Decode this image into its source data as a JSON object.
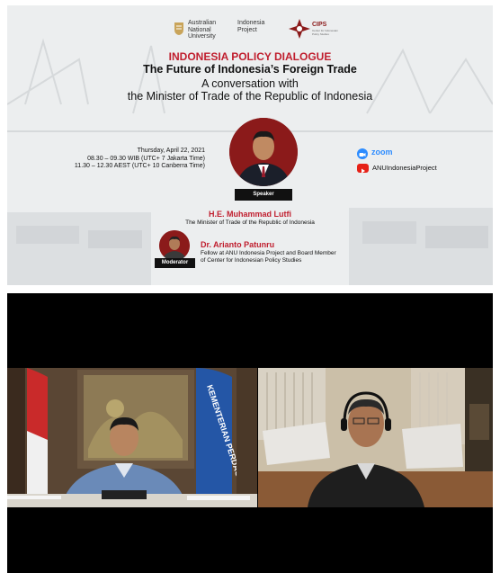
{
  "logos": {
    "anu": "Australian\nNational\nUniversity",
    "indonesia_project": "Indonesia\nProject",
    "cips": "CIPS",
    "cips_tagline": "Center for Indonesian Policy Studies"
  },
  "event": {
    "title": "INDONESIA POLICY DIALOGUE",
    "subtitle": "The Future of Indonesia’s Foreign Trade",
    "line3": "A conversation with",
    "line4": "the Minister of Trade of the Republic of Indonesia"
  },
  "schedule": {
    "date": "Thursday, April 22, 2021",
    "wib": "08.30 – 09.30 WIB (UTC+ 7 Jakarta Time)",
    "aest": "11.30 – 12.30 AEST (UTC+ 10 Canberra Time)"
  },
  "speaker": {
    "badge": "Speaker",
    "name": "H.E. Muhammad Lutfi",
    "role": "The Minister of Trade of the Republic of Indonesia"
  },
  "platforms": {
    "zoom": "zoom",
    "youtube": "ANUIndonesiaProject"
  },
  "moderator": {
    "badge": "Moderator",
    "name": "Dr. Arianto Patunru",
    "role_line1": "Fellow at ANU Indonesia Project and Board Member",
    "role_line2": "of Center for Indonesian Policy Studies"
  },
  "colors": {
    "accent_red": "#c01e2e",
    "zoom_blue": "#2d8cff",
    "youtube_red": "#e62117"
  },
  "meeting": {
    "banner_text": "KEMENTERIAN PERDAGANGAN REPUBLIK INDONESIA"
  }
}
